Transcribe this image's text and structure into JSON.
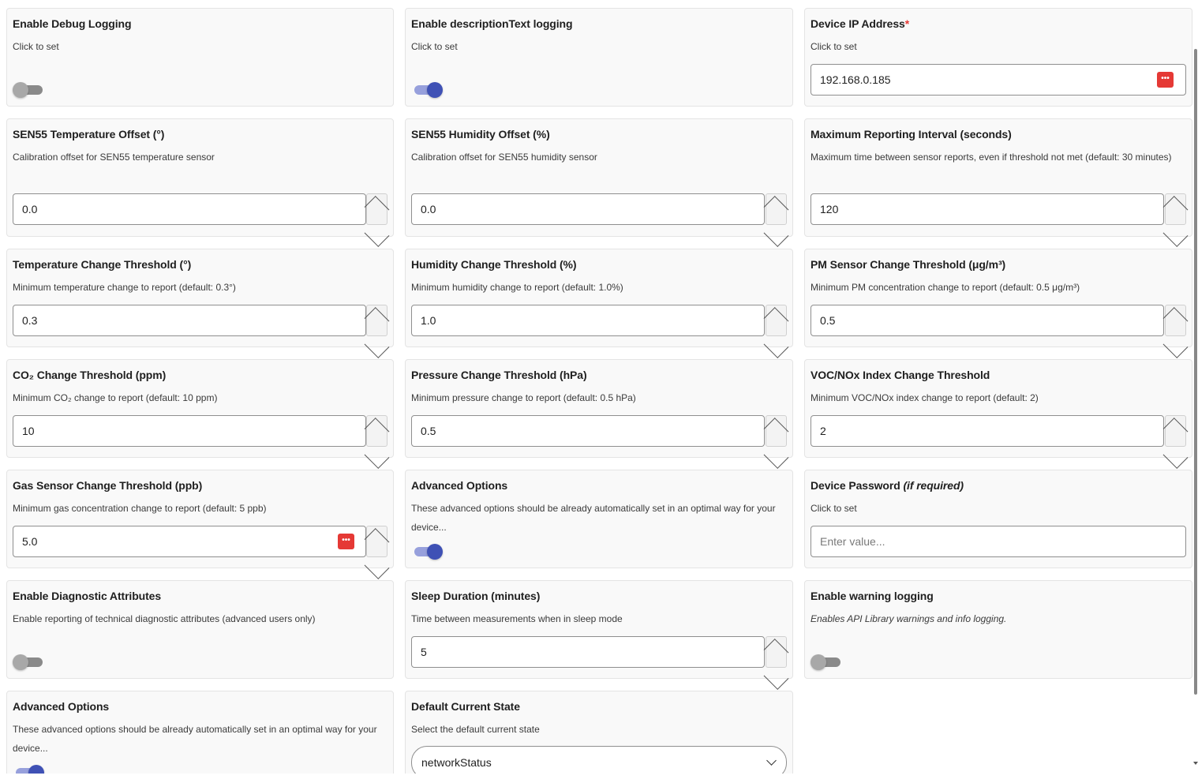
{
  "cards": {
    "debug_logging": {
      "title": "Enable Debug Logging",
      "desc": "Click to set",
      "enabled": false
    },
    "desc_text_logging": {
      "title": "Enable descriptionText logging",
      "desc": "Click to set",
      "enabled": true
    },
    "device_ip": {
      "title": "Device IP Address",
      "required_mark": "*",
      "desc": "Click to set",
      "value": "192.168.0.185",
      "icon": "password-manager-icon"
    },
    "temp_offset": {
      "title": "SEN55 Temperature Offset (°)",
      "desc": "Calibration offset for SEN55 temperature sensor",
      "value": "0.0"
    },
    "humidity_offset": {
      "title": "SEN55 Humidity Offset (%)",
      "desc": "Calibration offset for SEN55 humidity sensor",
      "value": "0.0"
    },
    "max_interval": {
      "title": "Maximum Reporting Interval (seconds)",
      "desc": "Maximum time between sensor reports, even if threshold not met (default: 30 minutes)",
      "value": "120"
    },
    "temp_threshold": {
      "title": "Temperature Change Threshold (°)",
      "desc": "Minimum temperature change to report (default: 0.3°)",
      "value": "0.3"
    },
    "humidity_threshold": {
      "title": "Humidity Change Threshold (%)",
      "desc": "Minimum humidity change to report (default: 1.0%)",
      "value": "1.0"
    },
    "pm_threshold": {
      "title": "PM Sensor Change Threshold (μg/m³)",
      "desc": "Minimum PM concentration change to report (default: 0.5 μg/m³)",
      "value": "0.5"
    },
    "co2_threshold": {
      "title": "CO₂ Change Threshold (ppm)",
      "desc": "Minimum CO₂ change to report (default: 10 ppm)",
      "value": "10"
    },
    "pressure_threshold": {
      "title": "Pressure Change Threshold (hPa)",
      "desc": "Minimum pressure change to report (default: 0.5 hPa)",
      "value": "0.5"
    },
    "voc_threshold": {
      "title": "VOC/NOx Index Change Threshold",
      "desc": "Minimum VOC/NOx index change to report (default: 2)",
      "value": "2"
    },
    "gas_threshold": {
      "title": "Gas Sensor Change Threshold (ppb)",
      "desc": "Minimum gas concentration change to report (default: 5 ppb)",
      "value": "5.0",
      "icon": "password-manager-icon"
    },
    "advanced_options_1": {
      "title": "Advanced Options",
      "desc": "These advanced options should be already automatically set in an optimal way for your device...",
      "enabled": true
    },
    "device_password": {
      "title": "Device Password",
      "title_note": "(if required)",
      "desc": "Click to set",
      "placeholder": "Enter value..."
    },
    "diagnostic_attrs": {
      "title": "Enable Diagnostic Attributes",
      "desc": "Enable reporting of technical diagnostic attributes (advanced users only)",
      "enabled": false
    },
    "sleep_duration": {
      "title": "Sleep Duration (minutes)",
      "desc": "Time between measurements when in sleep mode",
      "value": "5"
    },
    "warning_logging": {
      "title": "Enable warning logging",
      "desc": "Enables API Library warnings and info logging.",
      "enabled": false
    },
    "advanced_options_2": {
      "title": "Advanced Options",
      "desc": "These advanced options should be already automatically set in an optimal way for your device...",
      "enabled": true
    },
    "default_state": {
      "title": "Default Current State",
      "desc": "Select the default current state",
      "value": "networkStatus"
    }
  },
  "icon_text": "•••",
  "colors": {
    "accent": "#3f51b5",
    "required": "#e53935",
    "password_icon": "#e53935"
  }
}
